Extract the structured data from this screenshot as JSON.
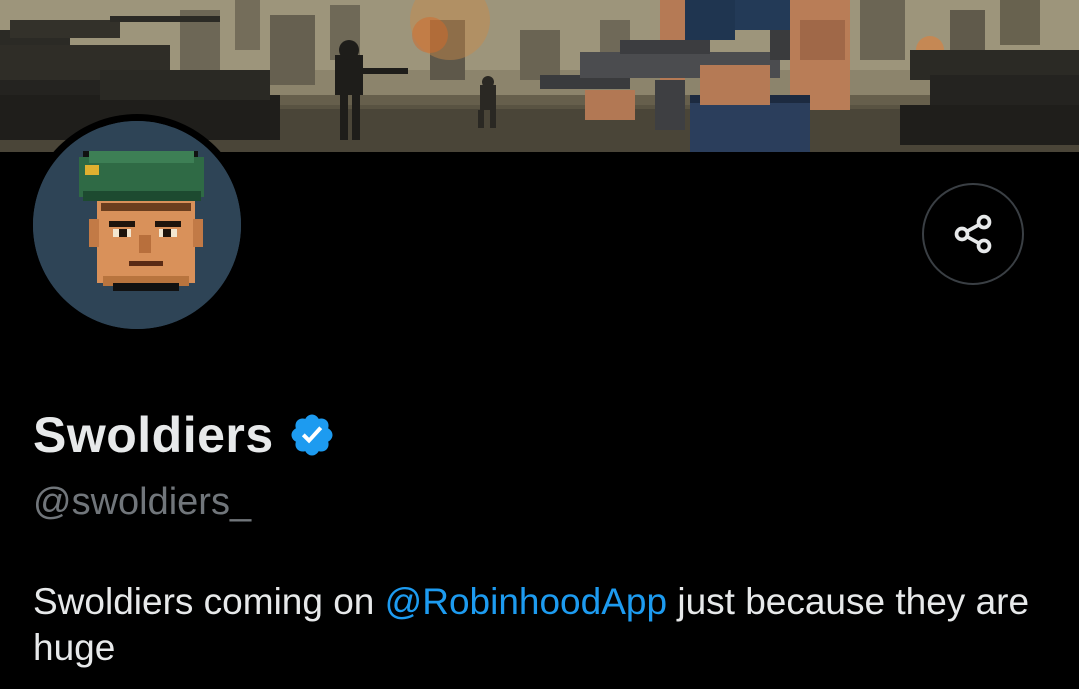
{
  "profile": {
    "display_name": "Swoldiers",
    "verified": true,
    "handle": "@swoldiers_",
    "bio": {
      "before": "Swoldiers coming on ",
      "mention": "@RobinhoodApp",
      "after": " just because they are huge"
    }
  },
  "icons": {
    "share": "share-icon",
    "verified": "verified-badge-icon"
  },
  "colors": {
    "background": "#000000",
    "text_primary": "#e7e9ea",
    "text_secondary": "#71767b",
    "accent": "#1d9bf0",
    "avatar_bg": "#2e4456"
  }
}
